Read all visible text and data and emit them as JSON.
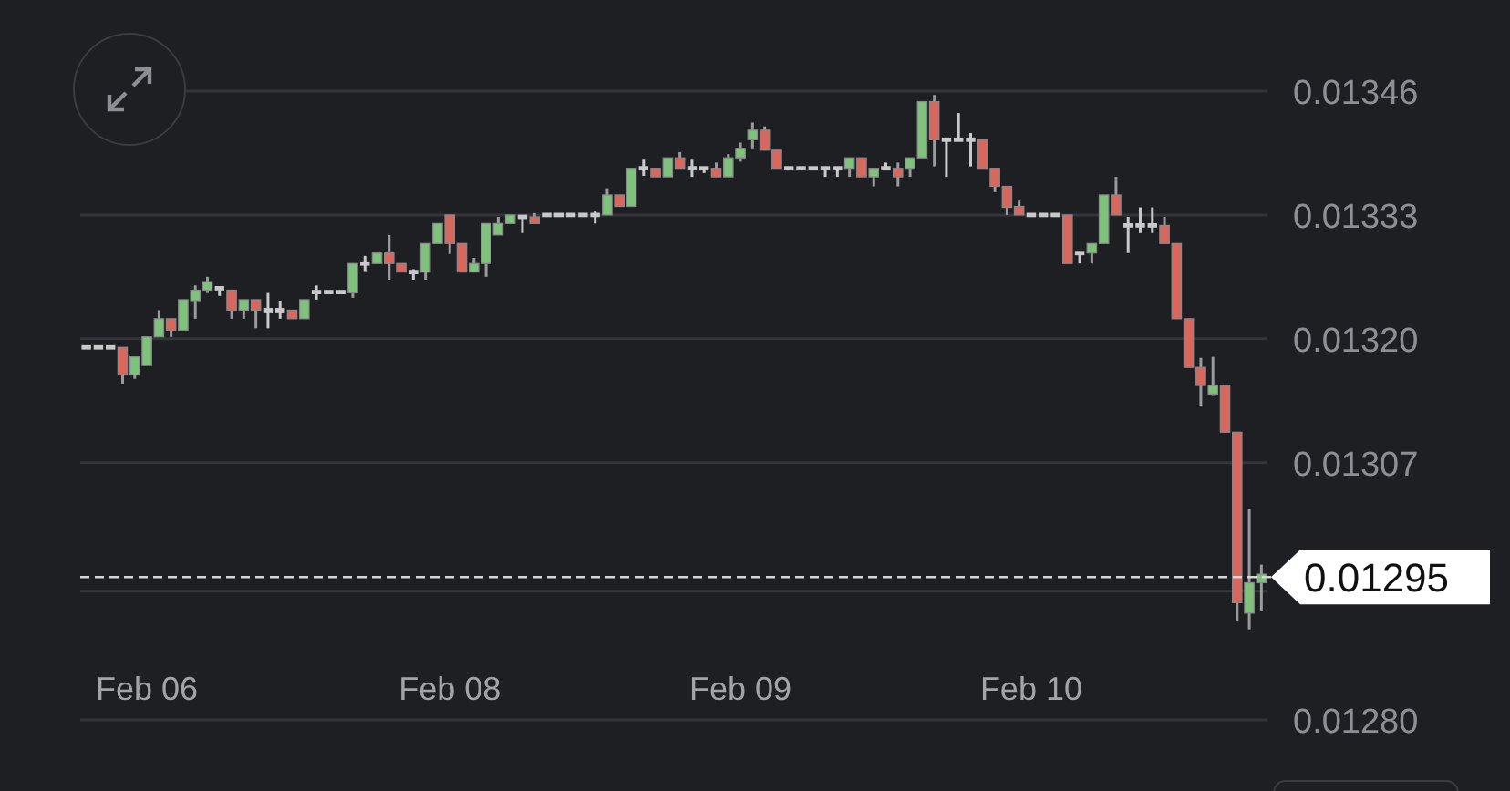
{
  "chart": {
    "chart_data": {
      "type": "candlestick",
      "categories": [
        null,
        null,
        null,
        null,
        null,
        "Feb 06",
        null,
        null,
        null,
        null,
        null,
        null,
        null,
        null,
        null,
        null,
        null,
        null,
        null,
        null,
        null,
        null,
        null,
        null,
        null,
        null,
        null,
        null,
        null,
        null,
        "Feb 08",
        null,
        null,
        null,
        null,
        null,
        null,
        null,
        null,
        null,
        null,
        null,
        null,
        null,
        null,
        null,
        null,
        null,
        null,
        null,
        null,
        null,
        null,
        null,
        "Feb 09",
        null,
        null,
        null,
        null,
        null,
        null,
        null,
        null,
        null,
        null,
        null,
        null,
        null,
        null,
        null,
        null,
        null,
        null,
        null,
        null,
        null,
        null,
        null,
        "Feb 10",
        null,
        null,
        null,
        null,
        null,
        null,
        null,
        null,
        null,
        null,
        null,
        null,
        null,
        null,
        null,
        null,
        null,
        null,
        null
      ],
      "ohlc": [
        [
          0.013191,
          0.013191,
          0.013191,
          0.013191
        ],
        [
          0.013191,
          0.013191,
          0.013191,
          0.013191
        ],
        [
          0.013191,
          0.013191,
          0.013191,
          0.013191
        ],
        [
          0.013191,
          0.013191,
          0.013153,
          0.013162
        ],
        [
          0.013162,
          0.013181,
          0.013158,
          0.013181
        ],
        [
          0.013172,
          0.013202,
          0.013172,
          0.013202
        ],
        [
          0.013202,
          0.01323,
          0.013202,
          0.013221
        ],
        [
          0.013221,
          0.013221,
          0.013202,
          0.013209
        ],
        [
          0.013209,
          0.013241,
          0.013209,
          0.013241
        ],
        [
          0.01324,
          0.013256,
          0.013221,
          0.013251
        ],
        [
          0.013251,
          0.013265,
          0.013249,
          0.01326
        ],
        [
          0.013253,
          0.013253,
          0.013245,
          0.013253
        ],
        [
          0.013251,
          0.013251,
          0.013221,
          0.01323
        ],
        [
          0.01323,
          0.013241,
          0.013221,
          0.013241
        ],
        [
          0.013241,
          0.013241,
          0.013211,
          0.01323
        ],
        [
          0.01323,
          0.013249,
          0.013211,
          0.01323
        ],
        [
          0.01323,
          0.01324,
          0.013221,
          0.01323
        ],
        [
          0.01323,
          0.01323,
          0.013221,
          0.013221
        ],
        [
          0.013221,
          0.013241,
          0.013221,
          0.013241
        ],
        [
          0.013249,
          0.013256,
          0.013241,
          0.013249
        ],
        [
          0.013249,
          0.013249,
          0.013249,
          0.013249
        ],
        [
          0.013249,
          0.013249,
          0.013249,
          0.013249
        ],
        [
          0.013249,
          0.013279,
          0.013243,
          0.013279
        ],
        [
          0.013279,
          0.013287,
          0.013271,
          0.013279
        ],
        [
          0.013279,
          0.01329,
          0.013279,
          0.01329
        ],
        [
          0.01329,
          0.013309,
          0.013262,
          0.013279
        ],
        [
          0.013279,
          0.013279,
          0.01327,
          0.01327
        ],
        [
          0.01327,
          0.013273,
          0.013262,
          0.01327
        ],
        [
          0.01327,
          0.0133,
          0.013262,
          0.0133
        ],
        [
          0.0133,
          0.013321,
          0.0133,
          0.013321
        ],
        [
          0.01333,
          0.01333,
          0.013289,
          0.0133
        ],
        [
          0.0133,
          0.0133,
          0.01327,
          0.01327
        ],
        [
          0.01327,
          0.013285,
          0.01327,
          0.013279
        ],
        [
          0.013279,
          0.013321,
          0.013265,
          0.013321
        ],
        [
          0.013309,
          0.013328,
          0.013309,
          0.013321
        ],
        [
          0.013321,
          0.01333,
          0.013321,
          0.01333
        ],
        [
          0.013328,
          0.013328,
          0.013311,
          0.013328
        ],
        [
          0.013328,
          0.013332,
          0.013321,
          0.013321
        ],
        [
          0.01333,
          0.01333,
          0.01333,
          0.01333
        ],
        [
          0.01333,
          0.01333,
          0.01333,
          0.01333
        ],
        [
          0.01333,
          0.01333,
          0.01333,
          0.01333
        ],
        [
          0.01333,
          0.01333,
          0.01333,
          0.01333
        ],
        [
          0.01333,
          0.013334,
          0.013321,
          0.01333
        ],
        [
          0.01333,
          0.013358,
          0.01333,
          0.013351
        ],
        [
          0.013351,
          0.013351,
          0.013339,
          0.013339
        ],
        [
          0.013339,
          0.013379,
          0.013339,
          0.013379
        ],
        [
          0.013379,
          0.013388,
          0.013371,
          0.013379
        ],
        [
          0.013379,
          0.013379,
          0.01337,
          0.01337
        ],
        [
          0.01337,
          0.01339,
          0.01337,
          0.01339
        ],
        [
          0.01339,
          0.013396,
          0.013379,
          0.013379
        ],
        [
          0.013379,
          0.013388,
          0.01337,
          0.013379
        ],
        [
          0.013379,
          0.013379,
          0.013374,
          0.013379
        ],
        [
          0.013379,
          0.013385,
          0.01337,
          0.01337
        ],
        [
          0.01337,
          0.013394,
          0.01337,
          0.01339
        ],
        [
          0.01339,
          0.013406,
          0.013386,
          0.0134
        ],
        [
          0.013409,
          0.013427,
          0.0134,
          0.013419
        ],
        [
          0.013419,
          0.013423,
          0.013398,
          0.013398
        ],
        [
          0.013398,
          0.013398,
          0.013379,
          0.013379
        ],
        [
          0.013379,
          0.013379,
          0.013379,
          0.013379
        ],
        [
          0.013379,
          0.013379,
          0.013379,
          0.013379
        ],
        [
          0.013379,
          0.013379,
          0.013379,
          0.013379
        ],
        [
          0.013379,
          0.013379,
          0.01337,
          0.013379
        ],
        [
          0.013379,
          0.013379,
          0.01337,
          0.013379
        ],
        [
          0.013379,
          0.01339,
          0.01337,
          0.01339
        ],
        [
          0.01339,
          0.01339,
          0.01337,
          0.01337
        ],
        [
          0.01337,
          0.013379,
          0.01336,
          0.013379
        ],
        [
          0.013379,
          0.013385,
          0.013379,
          0.013379
        ],
        [
          0.013379,
          0.013385,
          0.01336,
          0.01337
        ],
        [
          0.013379,
          0.01339,
          0.01337,
          0.01339
        ],
        [
          0.01339,
          0.013449,
          0.01339,
          0.013449
        ],
        [
          0.013449,
          0.013456,
          0.013381,
          0.013409
        ],
        [
          0.013409,
          0.013409,
          0.01337,
          0.013409
        ],
        [
          0.013409,
          0.013437,
          0.013409,
          0.013409
        ],
        [
          0.013409,
          0.013416,
          0.013381,
          0.013409
        ],
        [
          0.013409,
          0.013409,
          0.013379,
          0.013379
        ],
        [
          0.013379,
          0.013379,
          0.013354,
          0.01336
        ],
        [
          0.01336,
          0.01336,
          0.01333,
          0.013338
        ],
        [
          0.013339,
          0.013345,
          0.01333,
          0.01333
        ],
        [
          0.01333,
          0.01333,
          0.01333,
          0.01333
        ],
        [
          0.01333,
          0.01333,
          0.01333,
          0.01333
        ],
        [
          0.01333,
          0.01333,
          0.01333,
          0.01333
        ],
        [
          0.01333,
          0.01333,
          0.013279,
          0.013279
        ],
        [
          0.01329,
          0.01329,
          0.013279,
          0.01329
        ],
        [
          0.01329,
          0.0133,
          0.013279,
          0.0133
        ],
        [
          0.0133,
          0.013351,
          0.0133,
          0.013351
        ],
        [
          0.013351,
          0.01337,
          0.01333,
          0.01333
        ],
        [
          0.013319,
          0.013328,
          0.01329,
          0.013319
        ],
        [
          0.013319,
          0.013338,
          0.013311,
          0.013319
        ],
        [
          0.013319,
          0.013338,
          0.013311,
          0.013319
        ],
        [
          0.013319,
          0.013328,
          0.0133,
          0.0133
        ],
        [
          0.0133,
          0.0133,
          0.013221,
          0.013221
        ],
        [
          0.013221,
          0.013221,
          0.01317,
          0.01317
        ],
        [
          0.01317,
          0.01318,
          0.01313,
          0.013151
        ],
        [
          0.013142,
          0.013181,
          0.01314,
          0.013151
        ],
        [
          0.013151,
          0.013151,
          0.013102,
          0.013102
        ],
        [
          0.013102,
          0.013102,
          0.012904,
          0.012923
        ],
        [
          0.012912,
          0.013021,
          0.012895,
          0.012944
        ],
        [
          0.012944,
          0.012963,
          0.012914,
          0.012953
        ]
      ],
      "ylim": [
        0.0128,
        0.01346
      ],
      "grid": true,
      "yticks": [
        {
          "value": 0.01346,
          "label": "0.01346"
        },
        {
          "value": 0.01333,
          "label": "0.01333"
        },
        {
          "value": 0.0132,
          "label": "0.01320"
        },
        {
          "value": 0.01307,
          "label": "0.01307"
        },
        {
          "value": 0.0128,
          "label": "0.01280"
        }
      ],
      "ref_lines": [
        {
          "axis": "y",
          "value": 0.01295,
          "label": "0.01295",
          "color": "#d6d6d8"
        }
      ]
    }
  }
}
